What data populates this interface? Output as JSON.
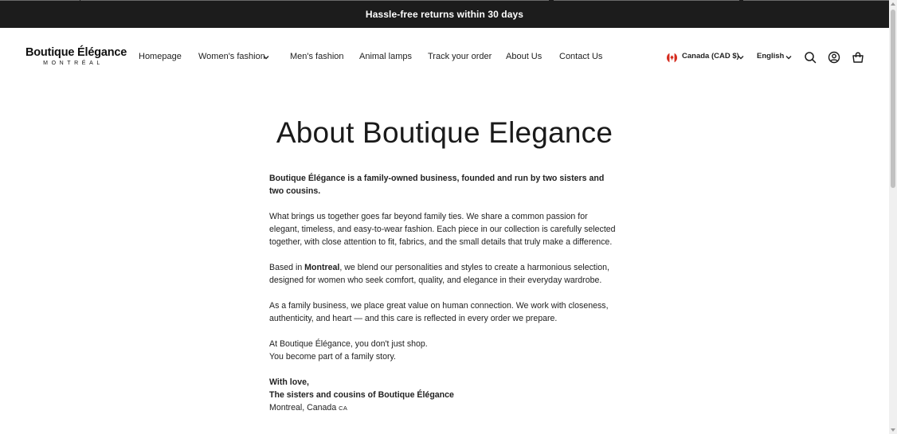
{
  "announcement": {
    "text": "Hassle-free returns within 30 days"
  },
  "logo": {
    "name": "Boutique Élégance",
    "city": "MONTRÉAL"
  },
  "nav": {
    "items": [
      {
        "label": "Homepage",
        "has_dropdown": false
      },
      {
        "label": "Women's fashion",
        "has_dropdown": true
      },
      {
        "label": "Men's fashion",
        "has_dropdown": false
      },
      {
        "label": "Animal lamps",
        "has_dropdown": false
      },
      {
        "label": "Track your order",
        "has_dropdown": false
      },
      {
        "label": "About Us",
        "has_dropdown": false
      },
      {
        "label": "Contact Us",
        "has_dropdown": false
      }
    ]
  },
  "locale": {
    "country_label": "Canada (CAD $)",
    "country_icon": "canada-flag-icon",
    "language_label": "English"
  },
  "header_icons": [
    "search-icon",
    "account-icon",
    "cart-icon"
  ],
  "page": {
    "title": "About Boutique Elegance",
    "intro": "Boutique Élégance is a family-owned business, founded and run by two sisters and two cousins.",
    "p1": "What brings us together goes far beyond family ties. We share a common passion for elegant, timeless, and easy-to-wear fashion. Each piece in our collection is carefully selected together, with close attention to fit, fabrics, and the small details that truly make a difference.",
    "p2_prefix": "Based in ",
    "p2_city": "Montreal",
    "p2_suffix": ", we blend our personalities and styles to create a harmonious selection, designed for women who seek comfort, quality, and elegance in their everyday wardrobe.",
    "p3": "As a family business, we place great value on human connection. We work with closeness, authenticity, and heart — and this care is reflected in every order we prepare.",
    "p4_line1": "At Boutique Élégance, you don't just shop.",
    "p4_line2": "You become part of a family story.",
    "sign_line1": "With love,",
    "sign_line2": "The sisters and cousins of Boutique Élégance",
    "sign_line3": "Montreal, Canada",
    "sign_flag_text": "CA"
  },
  "colors": {
    "announcement_bg": "#1c1c1c",
    "text": "#1a1a1a",
    "flag_red": "#d52b1e"
  }
}
